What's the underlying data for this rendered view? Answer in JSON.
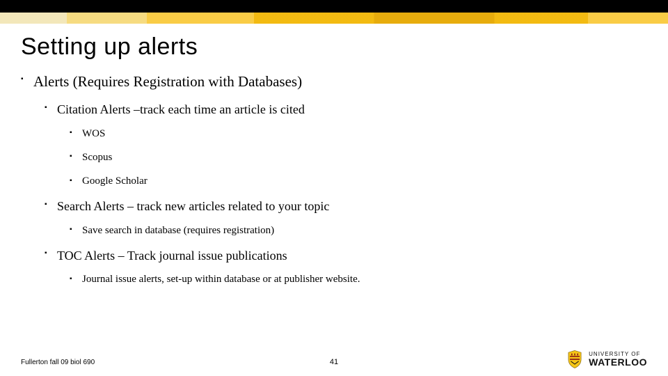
{
  "title": "Setting up alerts",
  "bullets": {
    "l1": "Alerts (Requires Registration with Databases)",
    "l2a": "Citation Alerts –track each time an article is cited",
    "l3a1": "WOS",
    "l3a2": "Scopus",
    "l3a3": "Google Scholar",
    "l2b": "Search Alerts – track new articles related to your topic",
    "l3b1": "Save search in database (requires registration)",
    "l2c": "TOC Alerts – Track journal issue publications",
    "l3c1": "Journal issue alerts, set-up within database or at publisher website."
  },
  "footer": {
    "left": "Fullerton fall 09 biol 690",
    "page": "41",
    "logo_top": "UNIVERSITY OF",
    "logo_bottom": "WATERLOO"
  }
}
